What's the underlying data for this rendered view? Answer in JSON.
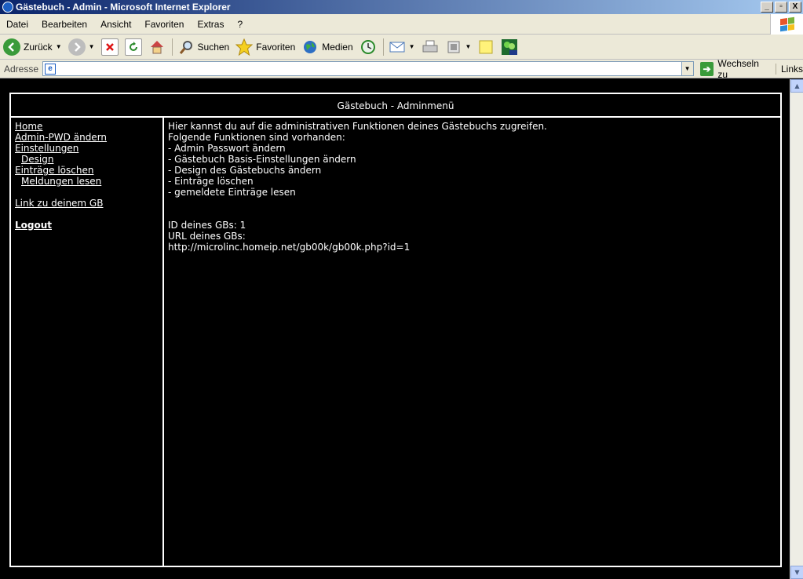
{
  "window": {
    "title": "Gästebuch - Admin - Microsoft Internet Explorer",
    "btn_min": "_",
    "btn_max": "▫",
    "btn_close": "X"
  },
  "menu": [
    "Datei",
    "Bearbeiten",
    "Ansicht",
    "Favoriten",
    "Extras",
    "?"
  ],
  "toolbar": {
    "back": "Zurück",
    "search": "Suchen",
    "favorites": "Favoriten",
    "media": "Medien"
  },
  "address": {
    "label": "Adresse",
    "value": "",
    "go": "Wechseln zu",
    "links": "Links"
  },
  "page": {
    "header": "Gästebuch - Adminmenü",
    "nav": {
      "home": "Home",
      "admin_pwd": "Admin-PWD ändern",
      "settings": "Einstellungen",
      "design": "Design",
      "delete_entries": "Einträge löschen",
      "read_reports": "Meldungen lesen",
      "link_gb": "Link zu deinem GB",
      "logout": "Logout"
    },
    "content": {
      "intro": "Hier kannst du auf die administrativen Funktionen deines Gästebuchs zugreifen.",
      "available": "Folgende Funktionen sind vorhanden:",
      "functions": [
        "- Admin Passwort ändern",
        "- Gästebuch Basis-Einstellungen ändern",
        "- Design des Gästebuchs ändern",
        "- Einträge löschen",
        "- gemeldete Einträge lesen"
      ],
      "id_label": "ID deines GBs: 1",
      "url_label": "URL deines GBs:",
      "url": "http://microlinc.homeip.net/gb00k/gb00k.php?id=1"
    }
  }
}
